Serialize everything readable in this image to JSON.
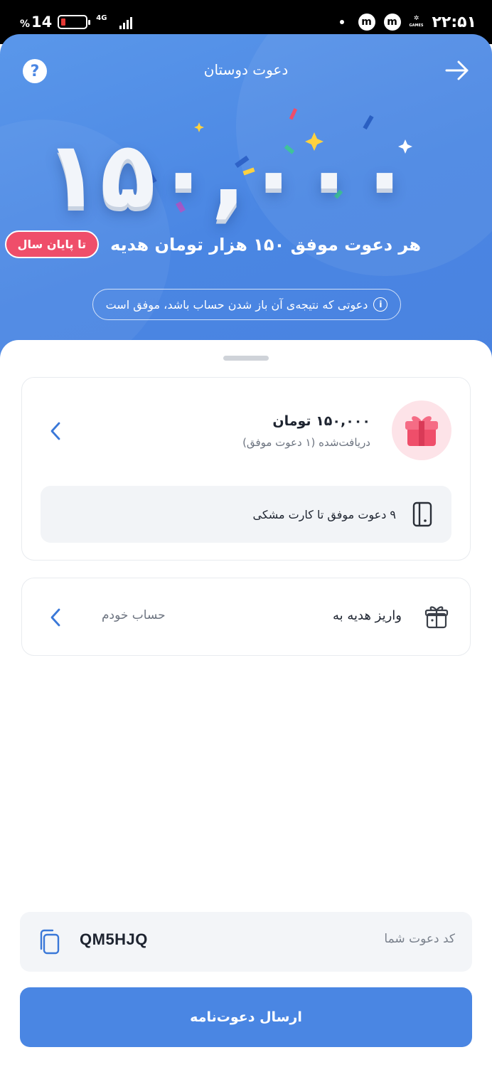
{
  "status_bar": {
    "battery_percent": "14",
    "battery_symbol": "%",
    "network": "4G",
    "time": "۲۲:۵۱",
    "app_icon_1": "m",
    "app_icon_2": "m",
    "games_label": "GAMES"
  },
  "header": {
    "title": "دعوت دوستان",
    "help_symbol": "?",
    "back_icon": "arrow-right-icon"
  },
  "hero": {
    "big_number": "۱۵۰,۰۰۰",
    "headline": "هر دعوت موفق ۱۵۰ هزار تومان هدیه",
    "badge": "تا پایان سال",
    "note": "دعوتی که نتیجه‌ی آن باز شدن حساب باشد، موفق است",
    "info_symbol": "i"
  },
  "reward_card": {
    "amount": "۱۵۰,۰۰۰ تومان",
    "subtitle": "دریافت‌شده (۱ دعوت موفق)",
    "progress_text": "۹ دعوت موفق تا کارت مشکی",
    "icon": "gift-icon",
    "progress_icon": "card-icon"
  },
  "deposit_card": {
    "label": "واریز هدیه به",
    "value": "حساب خودم",
    "icon": "gift-box-icon"
  },
  "invite_code": {
    "label": "کد دعوت شما",
    "code": "QM5HJQ",
    "icon": "copy-icon"
  },
  "send_button": {
    "label": "ارسال دعوت‌نامه"
  },
  "colors": {
    "primary": "#4a86e3",
    "badge": "#ef4e6a",
    "gift_bg": "#fde3e8"
  }
}
